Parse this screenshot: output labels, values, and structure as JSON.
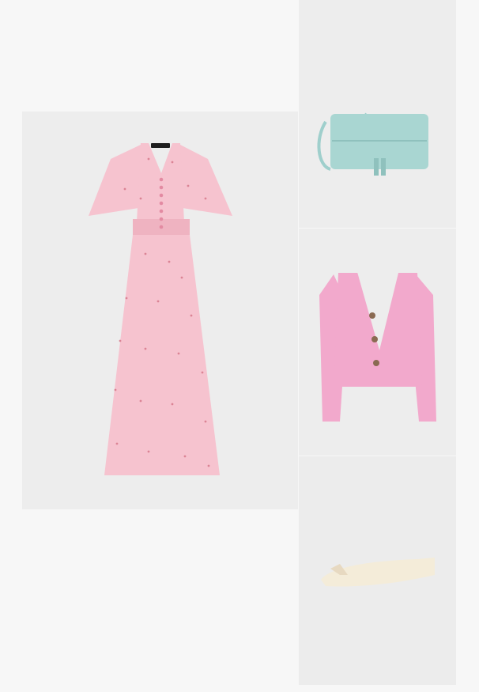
{
  "outfit": {
    "items": [
      {
        "name": "dress",
        "icon": "floral-midi-dress",
        "color": "#f6c3cf"
      },
      {
        "name": "bag",
        "icon": "clutch-bag",
        "color": "#a9d6d2"
      },
      {
        "name": "cardigan",
        "icon": "button-cardigan",
        "color": "#f2a9cc"
      },
      {
        "name": "shoes",
        "icon": "ballet-flat",
        "color": "#f4ecd9"
      }
    ],
    "background_color": "#ededed"
  },
  "dress_label": "",
  "colors": {
    "dress": "#f6c3cf",
    "dress_print": "#d77a8c",
    "bag": "#a9d6d2",
    "cardigan": "#f2a9cc",
    "button": "#8a6a52",
    "shoe": "#f4ecd9"
  }
}
